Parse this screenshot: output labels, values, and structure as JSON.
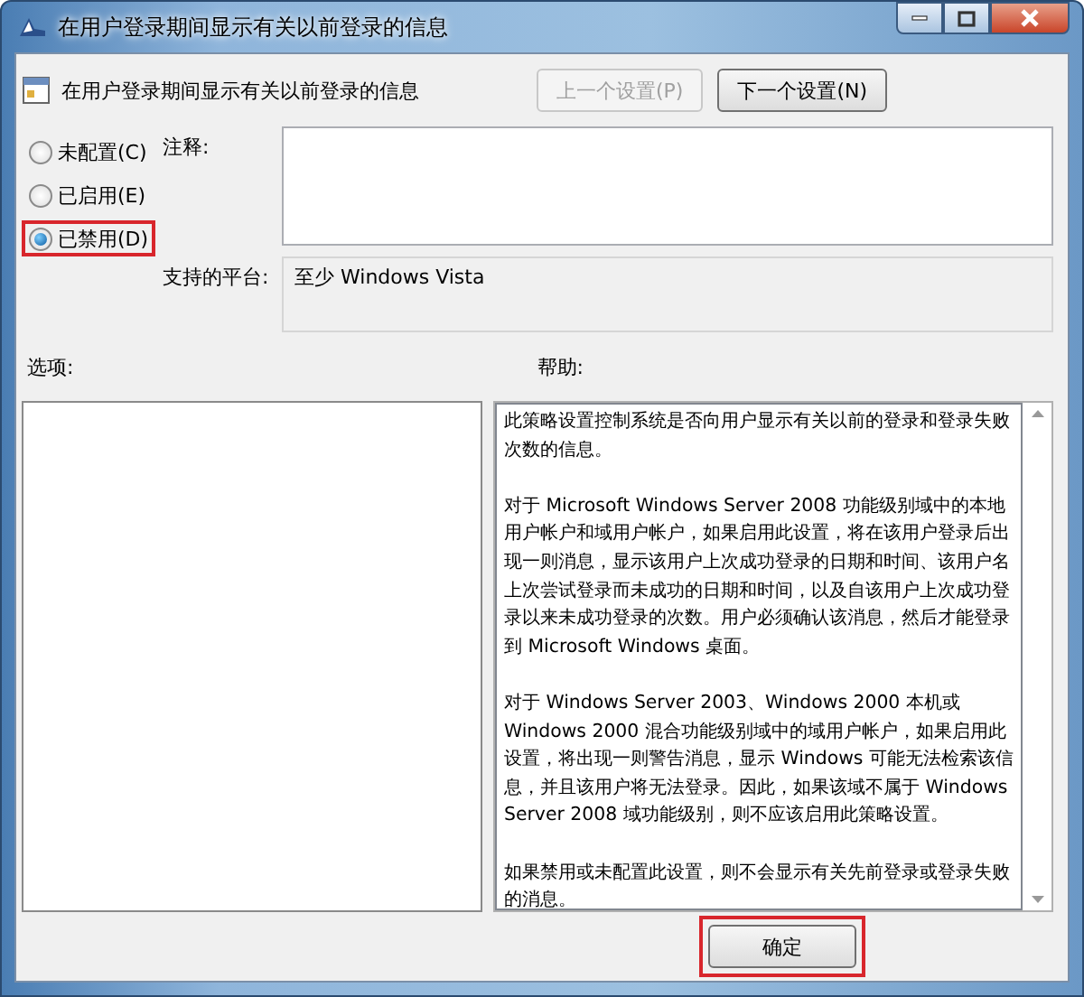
{
  "window": {
    "title": "在用户登录期间显示有关以前登录的信息"
  },
  "setting_title": "在用户登录期间显示有关以前登录的信息",
  "nav_buttons": [
    {
      "label": "上一个设置(P)",
      "disabled": true
    },
    {
      "label": "下一个设置(N)",
      "disabled": false
    }
  ],
  "options": [
    {
      "label": "未配置(C)",
      "selected": false,
      "highlighted": false
    },
    {
      "label": "已启用(E)",
      "selected": false,
      "highlighted": false
    },
    {
      "label": "已禁用(D)",
      "selected": true,
      "highlighted": true
    }
  ],
  "comment": {
    "label": "注释:"
  },
  "platform": {
    "label": "支持的平台:",
    "value": "至少 Windows Vista"
  },
  "options_label": "选项:",
  "help": {
    "label": "帮助:",
    "paragraphs": [
      "此策略设置控制系统是否向用户显示有关以前的登录和登录失败次数的信息。",
      "对于 Microsoft Windows Server 2008 功能级别域中的本地用户帐户和域用户帐户，如果启用此设置，将在该用户登录后出现一则消息，显示该用户上次成功登录的日期和时间、该用户名上次尝试登录而未成功的日期和时间，以及自该用户上次成功登录以来未成功登录的次数。用户必须确认该消息，然后才能登录到 Microsoft Windows 桌面。",
      "对于 Windows Server 2003、Windows 2000 本机或 Windows 2000 混合功能级别域中的域用户帐户，如果启用此设置，将出现一则警告消息，显示 Windows 可能无法检索该信息，并且该用户将无法登录。因此，如果该域不属于 Windows Server 2008 域功能级别，则不应该启用此策略设置。",
      "如果禁用或未配置此设置，则不会显示有关先前登录或登录失败的消息。"
    ]
  },
  "footer_buttons": [
    {
      "label": "确定",
      "highlighted": true
    }
  ]
}
